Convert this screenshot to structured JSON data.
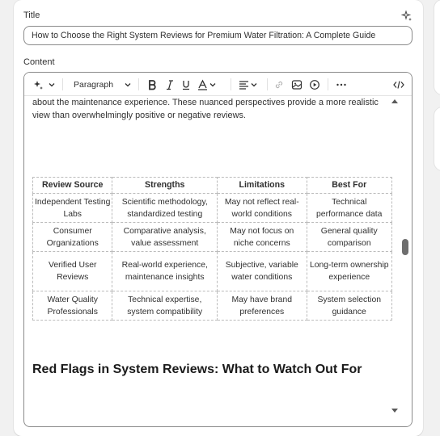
{
  "title_field": {
    "label": "Title",
    "value": "How to Choose the Right System Reviews for Premium Water Filtration: A Complete Guide"
  },
  "content_field": {
    "label": "Content"
  },
  "toolbar": {
    "ai_icon": "sparkle-icon",
    "paragraph_label": "Paragraph",
    "icons": [
      "bold-icon",
      "italic-icon",
      "underline-icon",
      "text-color-icon",
      "align-icon",
      "link-icon",
      "image-icon",
      "video-icon",
      "more-icon",
      "code-icon"
    ]
  },
  "editor": {
    "intro_text": "about the maintenance experience. These nuanced perspectives provide a more realistic view than overwhelmingly positive or negative reviews.",
    "table": {
      "headers": [
        "Review Source",
        "Strengths",
        "Limitations",
        "Best For"
      ],
      "rows": [
        [
          "Independent Testing Labs",
          "Scientific methodology, standardized testing",
          "May not reflect real-world conditions",
          "Technical performance data"
        ],
        [
          "Consumer Organizations",
          "Comparative analysis, value assessment",
          "May not focus on niche concerns",
          "General quality comparison"
        ],
        [
          "Verified User Reviews",
          "Real-world experience, maintenance insights",
          "Subjective, variable water conditions",
          "Long-term ownership experience"
        ],
        [
          "Water Quality Professionals",
          "Technical expertise, system compatibility",
          "May have brand preferences",
          "System selection guidance"
        ]
      ]
    },
    "section_heading": "Red Flags in System Reviews: What to Watch Out For"
  },
  "colors": {
    "border": "#8a8a8a",
    "text": "#303030",
    "background": "#f1f1f1"
  }
}
